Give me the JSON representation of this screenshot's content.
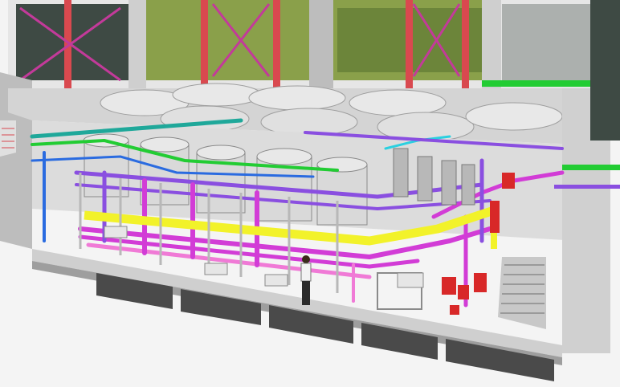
{
  "scene": {
    "kind": "3d-bim-cutaway",
    "subject": "mechanical room",
    "colors": {
      "background": "#f4f4f4",
      "concrete": "#cfcfcf",
      "concrete_dark": "#9e9e9e",
      "slab_shadow": "#4a4a4a",
      "foliage": "#8aa04a",
      "foliage_dark": "#4e6a2a",
      "window_dark": "#3e4a44",
      "steel_red": "#d9494f",
      "brace_magenta": "#c33a9a",
      "pipe_magenta": "#d23cd6",
      "pipe_purple": "#8a4fe0",
      "pipe_pink": "#f07ad6",
      "pipe_yellow": "#f2f22a",
      "pipe_green": "#22cc33",
      "pipe_teal": "#1fa89a",
      "pipe_blue": "#2a6be0",
      "pipe_cyan": "#2ad0e0",
      "equipment_red": "#d82828",
      "tank": "#d9d9d9",
      "stair": "#c8c8c8",
      "frame_grey": "#b8b8b8",
      "person_shirt": "#f2f2f2",
      "person_pants": "#2b2b2b"
    }
  }
}
